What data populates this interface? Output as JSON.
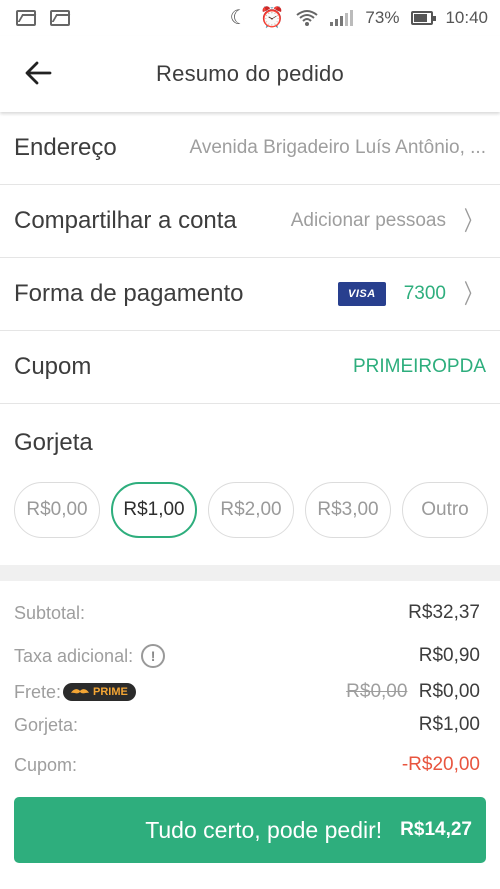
{
  "status_bar": {
    "battery_percent": "73%",
    "time": "10:40",
    "icons": [
      "image-icon",
      "image-icon",
      "moon-icon",
      "alarm-icon",
      "wifi-icon",
      "signal-icon",
      "battery-icon"
    ]
  },
  "header": {
    "title": "Resumo do pedido",
    "back_icon": "arrow-left-icon"
  },
  "rows": {
    "address": {
      "label": "Endereço",
      "value": "Avenida Brigadeiro Luís Antônio, ..."
    },
    "share": {
      "label": "Compartilhar a conta",
      "value": "Adicionar pessoas"
    },
    "payment": {
      "label": "Forma de pagamento",
      "card_brand": "VISA",
      "card_last_digits": "7300"
    },
    "coupon": {
      "label": "Cupom",
      "value": "PRIMEIROPDA"
    }
  },
  "tip": {
    "label": "Gorjeta",
    "options": [
      "R$0,00",
      "R$1,00",
      "R$2,00",
      "R$3,00",
      "Outro"
    ],
    "selected": "R$1,00"
  },
  "summary": {
    "subtotal": {
      "label": "Subtotal:",
      "value": "R$32,37"
    },
    "fee": {
      "label": "Taxa adicional:",
      "value": "R$0,90"
    },
    "delivery": {
      "label": "Frete:",
      "badge": "PRIME",
      "old_value": "R$0,00",
      "value": "R$0,00"
    },
    "tip": {
      "label": "Gorjeta:",
      "value": "R$1,00"
    },
    "coupon": {
      "label": "Cupom:",
      "value": "-R$20,00"
    }
  },
  "cta": {
    "label": "Tudo certo, pode pedir!",
    "total": "R$14,27"
  },
  "colors": {
    "accent": "#2eae7d",
    "discount": "#e8553f",
    "visa": "#283f8e"
  }
}
